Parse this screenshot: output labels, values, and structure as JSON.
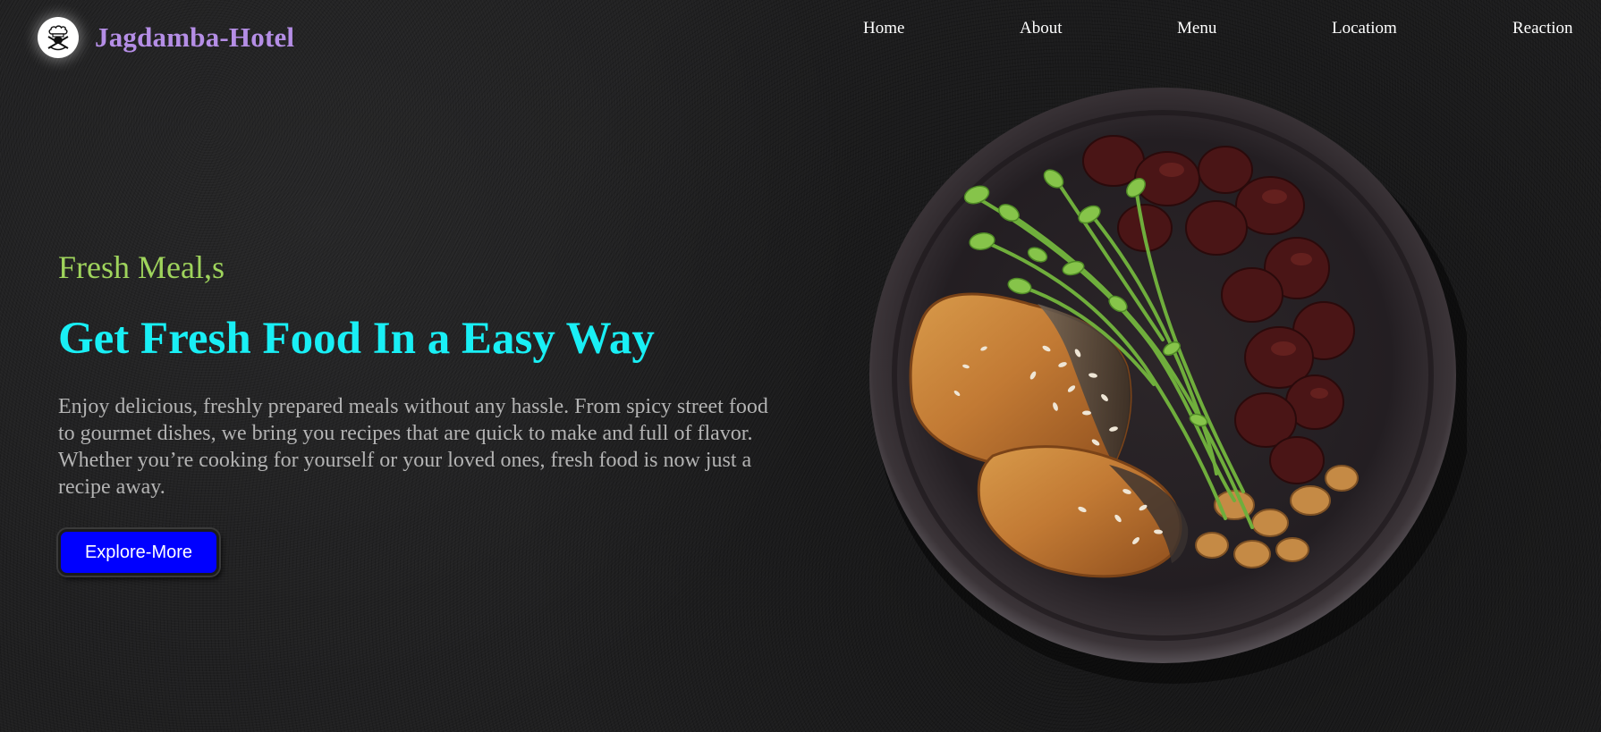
{
  "header": {
    "brand": "Jagdamba-Hotel",
    "logo_icon": "chef-emblem-icon",
    "nav": [
      {
        "label": "Home"
      },
      {
        "label": "About"
      },
      {
        "label": "Menu"
      },
      {
        "label": "Locatiom"
      },
      {
        "label": "Reaction"
      }
    ]
  },
  "hero": {
    "tagline": "Fresh Meal,s",
    "headline": "Get Fresh Food In a Easy Way",
    "description": "Enjoy delicious, freshly prepared meals without any hassle. From spicy street food to gourmet dishes, we bring you recipes that are quick to make and full of flavor. Whether you’re cooking for yourself or your loved ones, fresh food is now just a recipe away.",
    "cta_label": "Explore-More",
    "image": "plated-salmon-dish"
  },
  "colors": {
    "background": "#1f1f20",
    "brand": "#b58ee6",
    "tagline": "#9fd45c",
    "headline": "#19eff5",
    "body_text": "#b3b3b3",
    "button": "#0000ff"
  }
}
